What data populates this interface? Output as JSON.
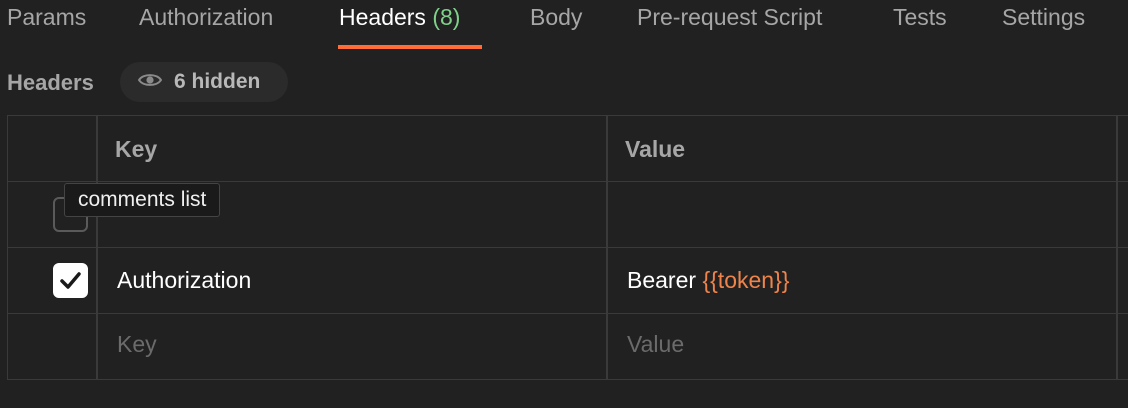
{
  "tabs": [
    {
      "label": "Params"
    },
    {
      "label": "Authorization"
    },
    {
      "label": "Headers",
      "count": "(8)"
    },
    {
      "label": "Body"
    },
    {
      "label": "Pre-request Script"
    },
    {
      "label": "Tests"
    },
    {
      "label": "Settings"
    }
  ],
  "active_tab": "Headers",
  "accent_color": "#ff6c37",
  "count_color": "#7fd18a",
  "section": {
    "title": "Headers",
    "hidden_label": "6 hidden",
    "hidden_icon": "eye-icon"
  },
  "table": {
    "columns": [
      "Key",
      "Value"
    ],
    "rows": [
      {
        "checked": false,
        "key": "",
        "value": ""
      },
      {
        "checked": true,
        "key": "Authorization",
        "value_prefix": "Bearer ",
        "value_var": "{{token}}"
      }
    ],
    "new_row": {
      "key_placeholder": "Key",
      "value_placeholder": "Value"
    }
  },
  "tooltip": {
    "text": "comments list"
  }
}
